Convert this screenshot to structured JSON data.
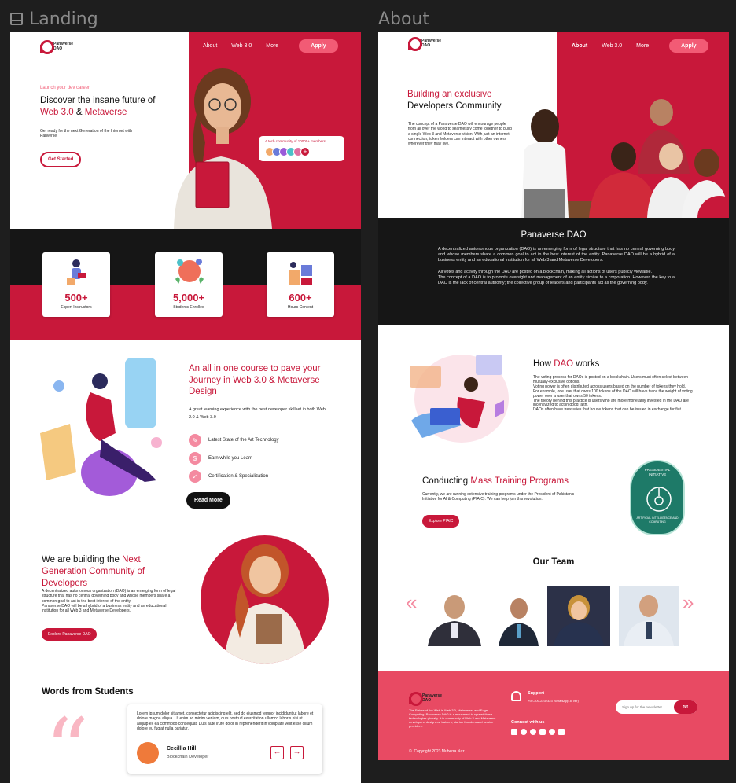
{
  "frames": {
    "landing_label": "Landing",
    "about_label": "About"
  },
  "brand": {
    "name_line1": "Panaverse",
    "name_line2": "DAO"
  },
  "colors": {
    "crimson": "#c8183a",
    "pink": "#f25b75",
    "dark": "#141414",
    "footer": "#e84a63"
  },
  "landing": {
    "nav": {
      "about": "About",
      "web3": "Web 3.0",
      "more": "More",
      "apply": "Apply"
    },
    "hero": {
      "eyebrow": "Launch your dev career",
      "title_line1": "Discover the insane future of",
      "title_web3": "Web 3.0",
      "title_amp": " & ",
      "title_metaverse": "Metaverse",
      "subtitle": "Get ready for the next Generation of the Internet with Panverse",
      "cta": "Get Started",
      "community_badge": "A tech community of 10000+ members"
    },
    "stats": [
      {
        "value": "500+",
        "label": "Expert Instructors"
      },
      {
        "value": "5,000+",
        "label": "Students Enrolled"
      },
      {
        "value": "600+",
        "label": "Hours Content"
      }
    ],
    "course": {
      "title": "An all in one course to pave your Journey in Web 3.0 & Metaverse Design",
      "subtitle": "A great learning experience with the best developer skillset in both Web 2.0 & Web 3.0",
      "features": [
        "Latest State of the Art Technology",
        "Earn while you Learn",
        "Certification & Specialization"
      ],
      "cta": "Read More"
    },
    "community": {
      "title_plain": "We are building the ",
      "title_red": "Next Generation Community of Developers",
      "body1": "A decentralized autonomous organization (DAO) is an emerging form of legal structure that has no central governing body and whose members share a common goal to act in the best interest of the entity.",
      "body2": "Panaverse DAO will be a hybrid of a business entity and an educational institution for all Web 3 and Metaverse Developers.",
      "cta": "Explore Panaverse DAO"
    },
    "testimonials": {
      "title": "Words from Students",
      "quote": "Lorem ipsum dolor sit amet, consectetur adipiscing elit, sed do eiusmod tempor incididunt ut labore et dolore magna aliqua. Ut enim ad minim veniam, quis nostrud exercitation ullamco laboris nisi ut aliquip ex ea commodo consequat. Duis aute irure dolor in reprehenderit in voluptate velit esse cillum dolore eu fugiat nulla pariatur.",
      "name": "Cecillia Hill",
      "role": "Blockchain Developer"
    }
  },
  "about": {
    "nav": {
      "about": "About",
      "web3": "Web 3.0",
      "more": "More",
      "apply": "Apply"
    },
    "hero": {
      "title_red": "Building an exclusive",
      "title_black": "Developers Community",
      "body": "The concept of a Panaverse DAO will encourage people from all over the world to seamlessly come together to build a single Web 3 and Metaverse vision. With just an internet connection, token holders can interact with other owners wherever they may live."
    },
    "dao": {
      "title": "Panaverse DAO",
      "p1": "A decentralized autonomous organization (DAO) is an emerging form of legal structure that has no central governing body and whose members share a common goal to act in the best interest of the entity. Panaverse DAO will be a hybrid of a business entity and an educational institution for all Web 3 and Metaverse Developers.",
      "p2": "All votes and activity through the DAO are posted on a blockchain, making all actions of users publicly viewable.",
      "p3": "The concept of a DAO is to promote oversight and management of an entity similar to a corporation. However, the key to a DAO is the lack of central authority; the collective group of leaders and participants act as the governing body."
    },
    "how": {
      "title_how": "How ",
      "title_dao": "DAO",
      "title_works": " works",
      "lines": [
        "The voting process for DAOs is posted on a blockchain. Users must often select between mutually-exclusive options.",
        "Voting power is often distributed across users based on the number of tokens they hold.",
        "For example, one user that owns 100 tokens of the DAO will have twice the weight of voting power over a user that owns 50 tokens.",
        "The theory behind this practice is users who are more monetarily invested in the DAO are incentivized to act in good faith.",
        "DAOs often have treasuries that house tokens that can be issued in exchange for fiat."
      ]
    },
    "training": {
      "title_plain": "Conducting ",
      "title_red": "Mass Training Programs",
      "body": "Currently, we are running extensive training programs under the President of Pakistan's Initiative for AI & Computing (PIAIC). We can help join this revolution.",
      "cta": "Explore PIAIC",
      "badge_top": "PRESIDENTIAL INITIATIVE",
      "badge_ring": "ARTIFICIAL INTELLIGENCE AND COMPUTING"
    },
    "team": {
      "title": "Our Team"
    },
    "footer": {
      "blurb": "The Future of the Web is Web 3.0, Metaverse, and Edge Computing. Panaverse DAO is a movement to spread these technologies globally. It is community of Web 3 and Metaverse developers, designers, trainers, startup founders and service providers.",
      "support_title": "Support",
      "support_phone": "+92-300-2232323 (WhatsApp.io ver)",
      "connect_title": "Connect with us",
      "newsletter_placeholder": "Sign up for the newsletter",
      "copyright": "Copyright 2023 Muberra Naz"
    }
  }
}
